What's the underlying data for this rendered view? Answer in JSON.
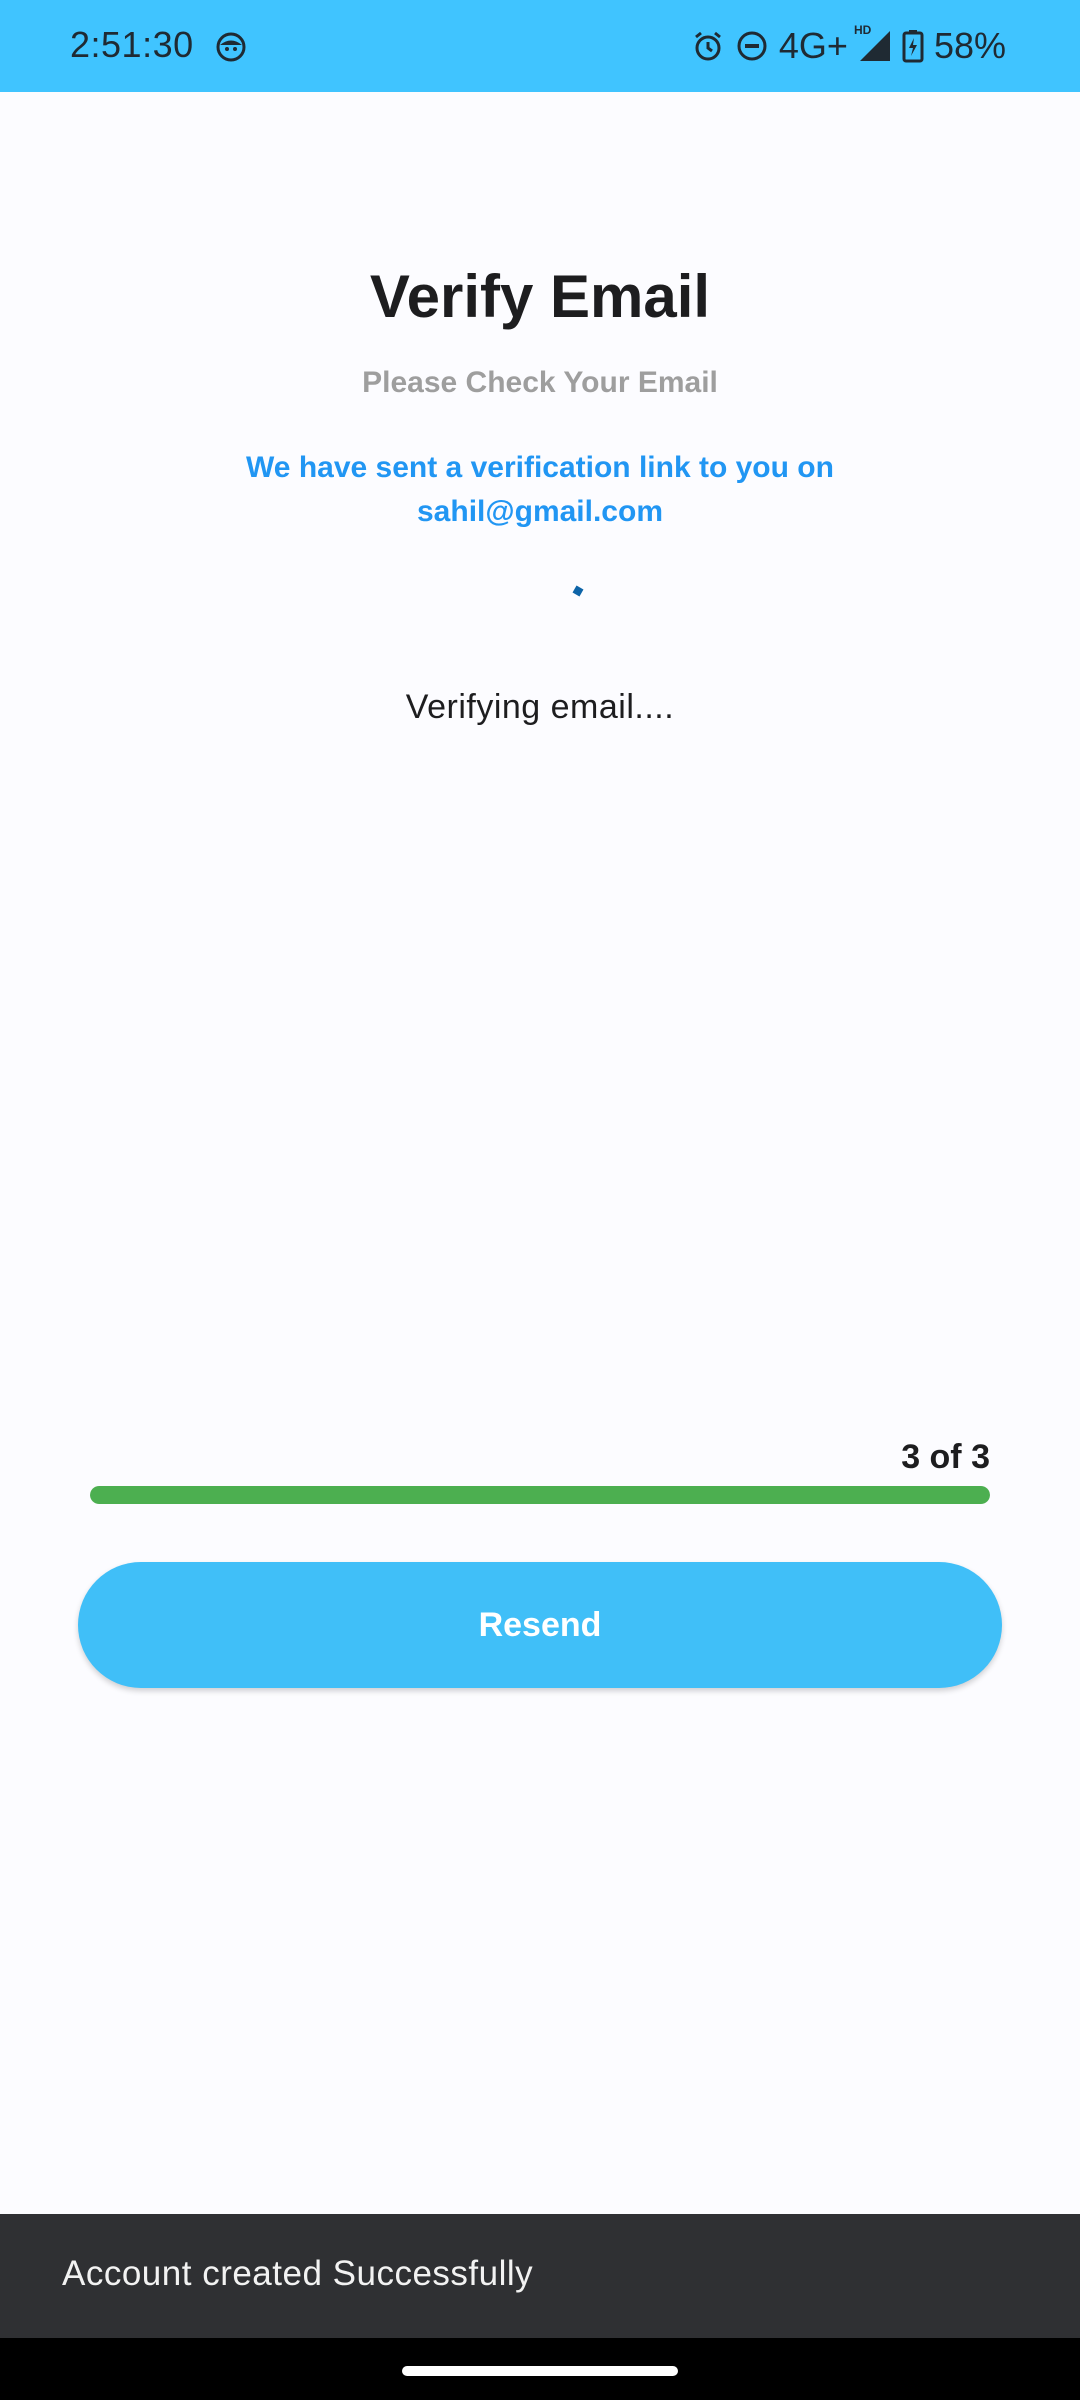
{
  "status_bar": {
    "time": "2:51:30",
    "network": "4G+",
    "hd_label": "HD",
    "battery": "58%",
    "icons": [
      "face-icon",
      "alarm-icon",
      "dnd-icon",
      "signal-icon",
      "battery-charging-icon"
    ],
    "background_color": "#40c4ff"
  },
  "screen": {
    "title": "Verify Email",
    "subtitle": "Please Check Your Email",
    "sent_line1": "We have sent a verification link to you on",
    "sent_email": "sahil@gmail.com",
    "verifying_text": "Verifying email...."
  },
  "progress": {
    "label": "3 of 3",
    "current": 3,
    "total": 3,
    "fraction": 1.0,
    "color": "#4caf50"
  },
  "actions": {
    "resend_label": "Resend",
    "resend_color": "#40bff8"
  },
  "snackbar": {
    "message": "Account created Successfully"
  },
  "accent_color": "#2196f3"
}
